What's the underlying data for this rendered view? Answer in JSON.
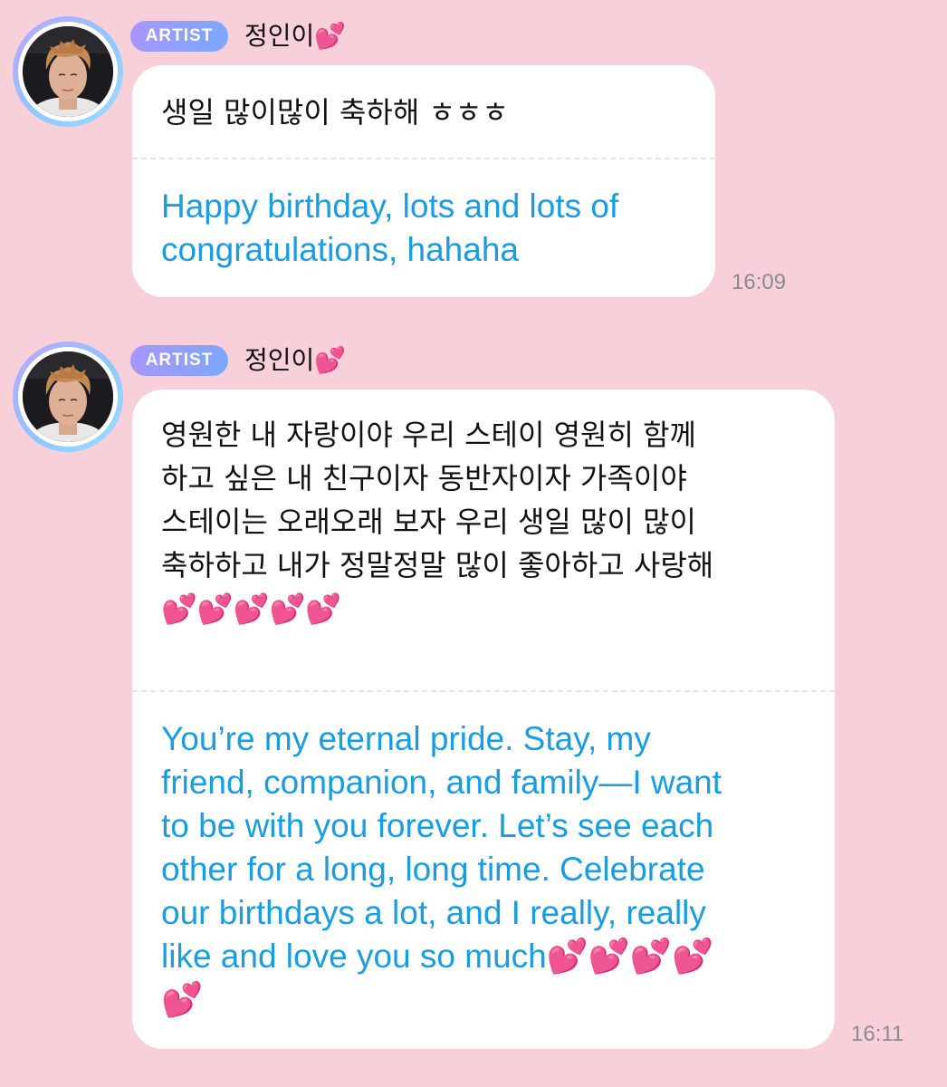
{
  "messages": [
    {
      "badge": "ARTIST",
      "sender": "정인이💕",
      "korean": "생일 많이많이 축하해 ㅎㅎㅎ",
      "english": "Happy birthday, lots and lots of\ncongratulations, hahaha",
      "time": "16:09"
    },
    {
      "badge": "ARTIST",
      "sender": "정인이💕",
      "korean": "영원한 내 자랑이야 우리 스테이 영원히 함께\n하고 싶은 내 친구이자 동반자이자 가족이야\n스테이는 오래오래 보자 우리 생일 많이 많이\n축하하고 내가 정말정말 많이 좋아하고 사랑해\n💕💕💕💕💕",
      "english": "You’re my eternal pride. Stay, my\nfriend, companion, and family—I want\nto be with you forever. Let’s see each\nother for a long, long time. Celebrate\nour birthdays a lot, and I really, really\nlike and love you so much💕💕💕💕\n💕",
      "time": "16:11"
    }
  ],
  "colors": {
    "background": "#f7d0d9",
    "bubble": "#ffffff",
    "translation_text": "#1a9de0",
    "badge_start": "#a896ff",
    "badge_end": "#7ba8ff",
    "heart": "#ff4fa3"
  },
  "icons": [
    "avatar-photo",
    "two-hearts-emoji"
  ]
}
